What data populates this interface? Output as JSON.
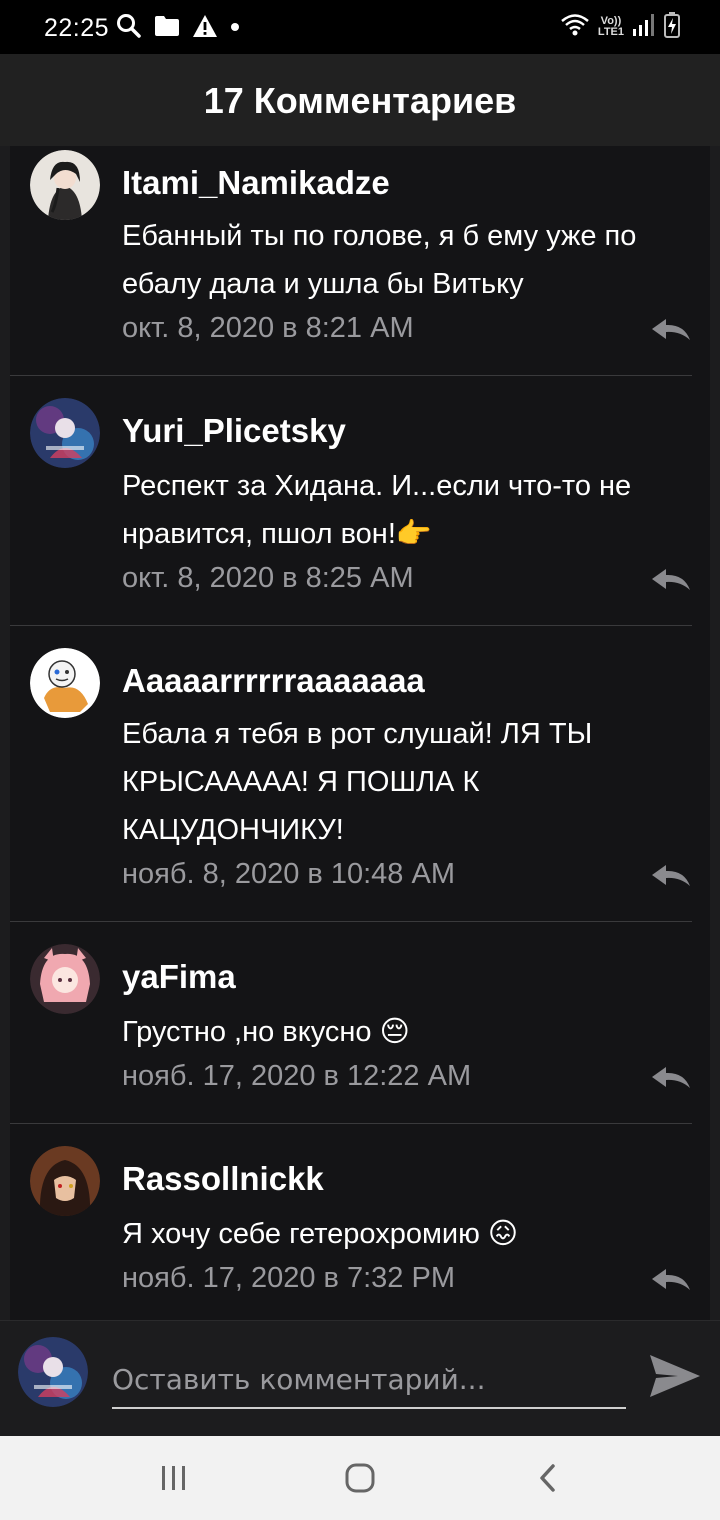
{
  "status_bar": {
    "time": "22:25",
    "network_top": "Vo))",
    "network_bottom": "LTE1",
    "icons": [
      "search-icon",
      "folder-icon",
      "warning-icon",
      "dot-icon",
      "wifi-icon",
      "signal-icon",
      "battery-icon"
    ]
  },
  "header": {
    "title": "17 Комментариев"
  },
  "comments": [
    {
      "username": "Itami_Namikadze",
      "text": "Ебанный ты по голове, я б ему уже по ебалу дала и ушла бы Витьку",
      "timestamp": "окт. 8, 2020 в 8:21 AM"
    },
    {
      "username": "Yuri_Plicetsky",
      "text": "Респект за Хидана. И...если что-то не нравится, пшол вон!👉",
      "timestamp": "окт. 8, 2020 в 8:25 AM"
    },
    {
      "username": "Aaaaarrrrrraaaaaaa",
      "text": "Ебала я тебя в рот слушай! ЛЯ ТЫ КРЫСААААА! Я ПОШЛА К КАЦУДОНЧИКУ!",
      "timestamp": "нояб. 8, 2020 в 10:48 AM"
    },
    {
      "username": "yaFima",
      "text": "Грустно ,но вкусно 😔",
      "timestamp": "нояб. 17, 2020 в 12:22 AM"
    },
    {
      "username": "Rassollnickk",
      "text": "Я хочу себе гетерохромию 😖",
      "timestamp": "нояб. 17, 2020 в 7:32 PM"
    }
  ],
  "composer": {
    "placeholder": "Оставить комментарий..."
  },
  "colors": {
    "background": "#141416",
    "header": "#212121",
    "timestamp": "#9a9a9e",
    "navbar": "#f2f2f2"
  }
}
